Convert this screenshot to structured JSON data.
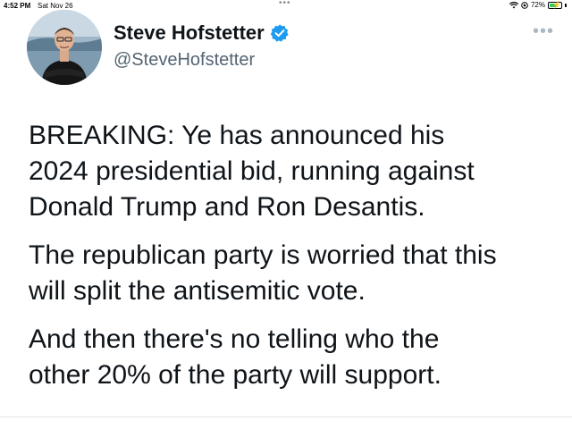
{
  "status_bar": {
    "time": "4:52 PM",
    "date": "Sat Nov 26",
    "battery_text": "72%",
    "battery_level": 0.72,
    "dots": "•••"
  },
  "tweet": {
    "display_name": "Steve Hofstetter",
    "handle": "@SteveHofstetter",
    "verified": true,
    "more_icon": "•••",
    "paragraphs": [
      "BREAKING: Ye has announced his\n2024 presidential bid, running against\nDonald Trump and Ron Desantis.",
      "The republican party is worried that this\nwill split the antisemitic vote.",
      "And then there's no telling who the\nother 20% of the party will support."
    ]
  },
  "colors": {
    "verified_blue": "#1d9bf0",
    "handle_gray": "#536471",
    "text": "#0f1419"
  },
  "icons": [
    "wifi-icon",
    "location-icon",
    "battery-icon",
    "verified-badge-icon",
    "more-options-icon",
    "avatar"
  ]
}
